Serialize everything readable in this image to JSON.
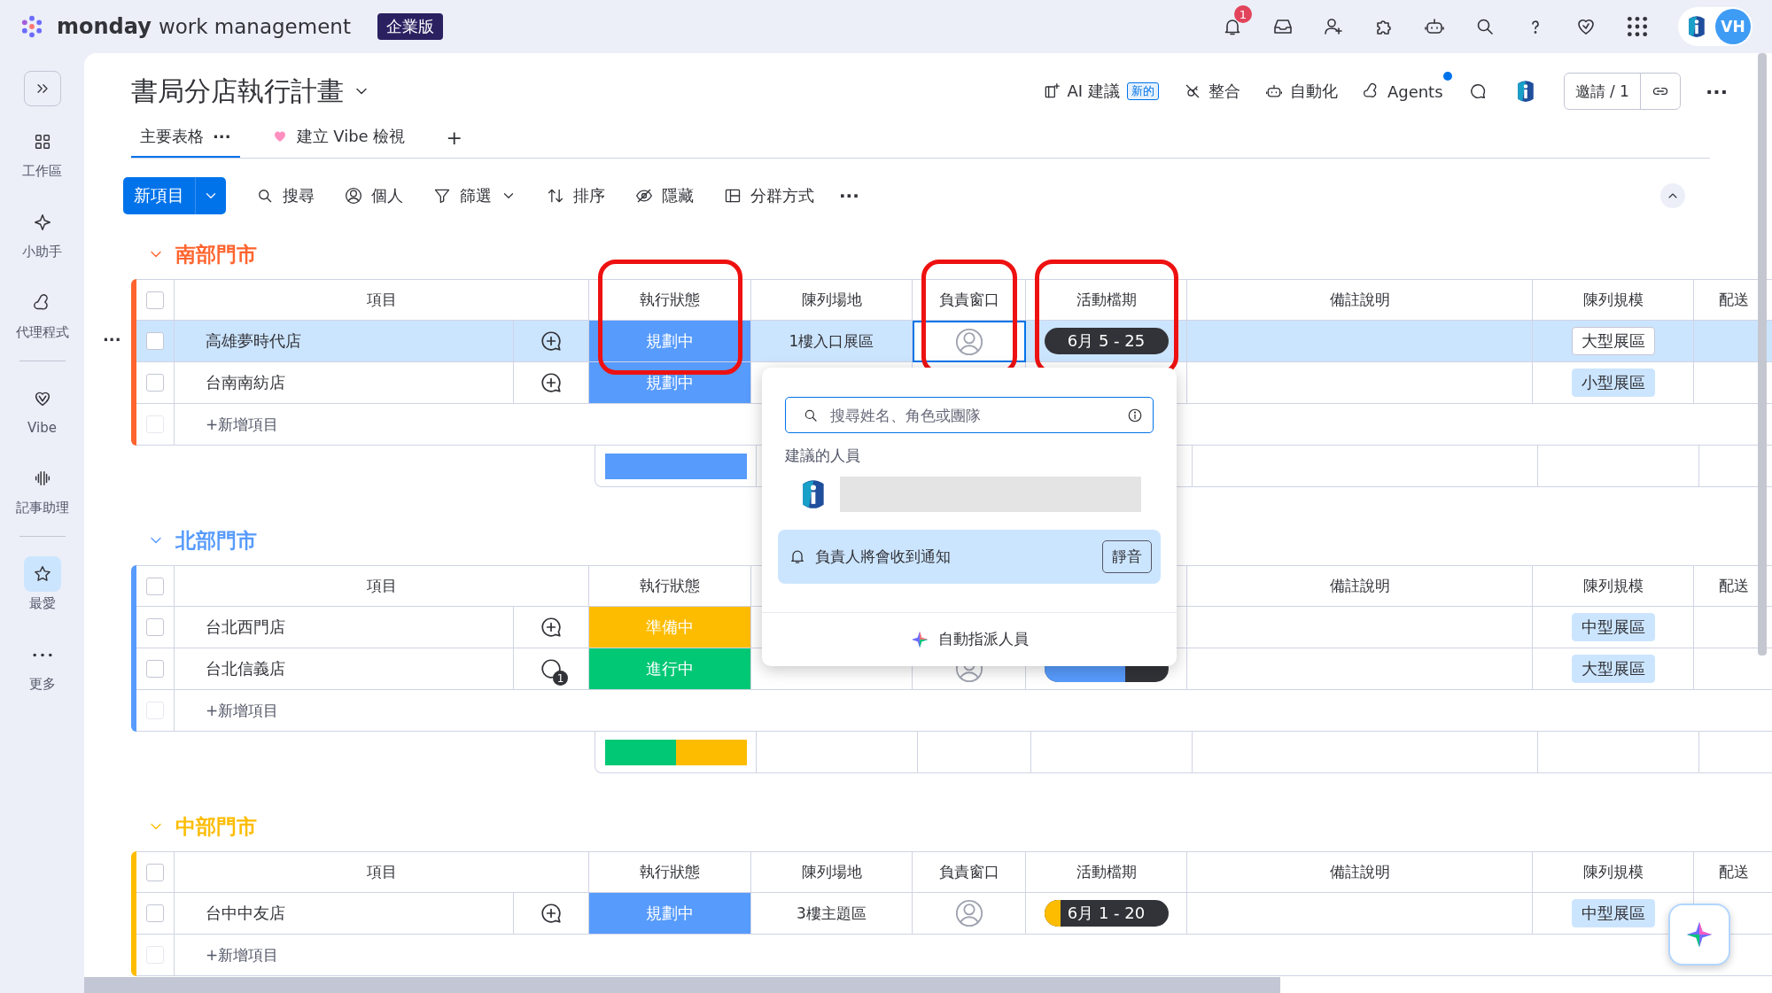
{
  "topbar": {
    "brand": "monday",
    "product": "work management",
    "plan_badge": "企業版",
    "notification_count": "1",
    "avatar_initials": "VH"
  },
  "sidebar": {
    "items": [
      {
        "kind": "item",
        "label": "工作區",
        "selected": false
      },
      {
        "kind": "item",
        "label": "小助手",
        "selected": false
      },
      {
        "kind": "item",
        "label": "代理程式",
        "selected": false
      },
      {
        "kind": "divider"
      },
      {
        "kind": "item",
        "label": "Vibe",
        "selected": false
      },
      {
        "kind": "item",
        "label": "記事助理",
        "selected": false
      },
      {
        "kind": "divider"
      },
      {
        "kind": "item",
        "label": "最愛",
        "selected": true
      },
      {
        "kind": "more",
        "label": "更多",
        "selected": false
      }
    ]
  },
  "board": {
    "title": "書局分店執行計畫",
    "actions": [
      {
        "label": "AI 建議",
        "badge": "新的",
        "notify": false
      },
      {
        "label": "整合",
        "notify": false
      },
      {
        "label": "自動化",
        "notify": false
      },
      {
        "label": "Agents",
        "notify": true
      }
    ],
    "invite": "邀請 / 1",
    "more": "···"
  },
  "tabs": [
    {
      "label": "主要表格",
      "selected": true,
      "menu": "···"
    },
    {
      "label": "建立 Vibe 檢視",
      "selected": false
    }
  ],
  "add_view": "+",
  "toolbar": {
    "new_item": "新項目",
    "tools": [
      {
        "label": "搜尋",
        "dropdown": false
      },
      {
        "label": "個人",
        "dropdown": false
      },
      {
        "label": "篩選",
        "dropdown": true
      },
      {
        "label": "排序",
        "dropdown": false
      },
      {
        "label": "隱藏",
        "dropdown": false
      },
      {
        "label": "分群方式",
        "dropdown": false
      }
    ],
    "more": "···"
  },
  "groups": [
    {
      "name": "南部門市",
      "color": "#ff642e",
      "expanded": true,
      "all_checked": false,
      "columns": [
        {
          "kind": "item",
          "label": "項目",
          "highlighted": false
        },
        {
          "kind": "status",
          "label": "執行狀態",
          "highlighted": true
        },
        {
          "kind": "location",
          "label": "陳列場地",
          "highlighted": false
        },
        {
          "kind": "people",
          "label": "負責窗口",
          "highlighted": true
        },
        {
          "kind": "timeline",
          "label": "活動檔期",
          "highlighted": true
        },
        {
          "kind": "notes",
          "label": "備註說明",
          "highlighted": false
        },
        {
          "kind": "size",
          "label": "陳列規模",
          "highlighted": false
        },
        {
          "kind": "delivery",
          "label": "配送",
          "highlighted": false
        }
      ],
      "rows": [
        {
          "item": "高雄夢時代店",
          "checked": false,
          "selected": true,
          "updates": null,
          "status": {
            "label": "規劃中",
            "color": "#579bfc"
          },
          "location": "1樓入口展區",
          "owner_assigned": false,
          "owner_focused": true,
          "timeline": {
            "label": "6月 5 - 25",
            "level": 0
          },
          "size": "大型展區"
        },
        {
          "item": "台南南紡店",
          "checked": false,
          "selected": false,
          "updates": null,
          "status": {
            "label": "規劃中",
            "color": "#579bfc"
          },
          "size": "小型展區"
        }
      ],
      "add_row": {
        "label": "+新增項目",
        "checkbox_disabled": true
      },
      "summary": [
        {
          "color": "#579bfc",
          "level": 1
        }
      ]
    },
    {
      "name": "北部門市",
      "color": "#579bfc",
      "expanded": true,
      "all_checked": false,
      "columns": [
        {
          "kind": "item",
          "label": "項目",
          "highlighted": false
        },
        {
          "kind": "status",
          "label": "執行狀態",
          "highlighted": false
        },
        {
          "kind": "notes",
          "label": "備註說明",
          "highlighted": false
        },
        {
          "kind": "size",
          "label": "陳列規模",
          "highlighted": false
        },
        {
          "kind": "delivery",
          "label": "配送",
          "highlighted": false
        }
      ],
      "rows": [
        {
          "item": "台北西門店",
          "checked": false,
          "selected": false,
          "updates": null,
          "status": {
            "label": "準備中",
            "color": "#fdbc00"
          },
          "size": "中型展區"
        },
        {
          "item": "台北信義店",
          "checked": false,
          "selected": false,
          "updates": "1",
          "status": {
            "label": "進行中",
            "color": "#00c875"
          },
          "owner_assigned": false,
          "owner_focused": false,
          "timeline": {
            "level": 0.65
          },
          "size": "大型展區"
        }
      ],
      "add_row": {
        "label": "+新增項目",
        "checkbox_disabled": true
      },
      "summary": [
        {
          "color": "#00c875",
          "level": 0.5
        },
        {
          "color": "#fdbc00",
          "level": 0.5
        }
      ]
    },
    {
      "name": "中部門市",
      "color": "#fdbc00",
      "expanded": true,
      "all_checked": false,
      "columns": [
        {
          "kind": "item",
          "label": "項目",
          "highlighted": false
        },
        {
          "kind": "status",
          "label": "執行狀態",
          "highlighted": false
        },
        {
          "kind": "location",
          "label": "陳列場地",
          "highlighted": false
        },
        {
          "kind": "people",
          "label": "負責窗口",
          "highlighted": false
        },
        {
          "kind": "timeline",
          "label": "活動檔期",
          "highlighted": false
        },
        {
          "kind": "notes",
          "label": "備註說明",
          "highlighted": false
        },
        {
          "kind": "size",
          "label": "陳列規模",
          "highlighted": false
        },
        {
          "kind": "delivery",
          "label": "配送",
          "highlighted": false
        }
      ],
      "rows": [
        {
          "item": "台中中友店",
          "checked": false,
          "selected": false,
          "updates": null,
          "status": {
            "label": "規劃中",
            "color": "#579bfc"
          },
          "location": "3樓主題區",
          "owner_assigned": false,
          "owner_focused": false,
          "timeline": {
            "label": "6月 1 - 20",
            "level": 0.13
          },
          "size": "中型展區"
        }
      ],
      "add_row": {
        "label": "+新增項目",
        "checkbox_disabled": true
      }
    }
  ],
  "assign_popup": {
    "search": {
      "placeholder": "搜尋姓名、角色或團隊"
    },
    "suggested_label": "建議的人員",
    "notice": "負責人將會收到通知",
    "mute": "靜音",
    "auto_assign": "自動指派人員"
  }
}
